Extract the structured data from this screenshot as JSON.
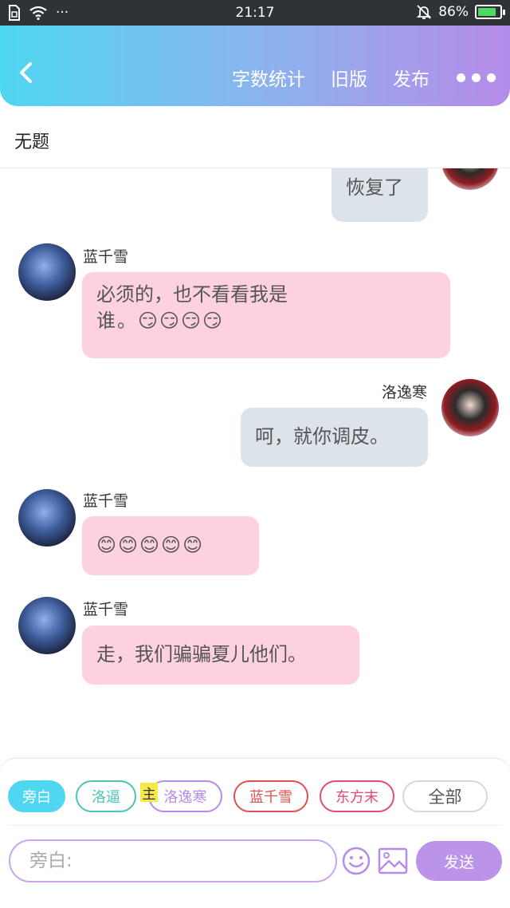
{
  "status_bar": {
    "time": "21:17",
    "battery": "86%",
    "battery_level": 0.86,
    "dots": "···"
  },
  "header": {
    "word_count": "字数统计",
    "old_version": "旧版",
    "publish": "发布"
  },
  "document": {
    "title": "无题"
  },
  "messages": [
    {
      "speaker": "",
      "text": "恢复了",
      "side": "right"
    },
    {
      "speaker": "蓝千雪",
      "line1": "必须的，也不看看我是",
      "line2": "谁。😏😏😏😏",
      "side": "left"
    },
    {
      "speaker": "洛逸寒",
      "text": "呵，就你调皮。",
      "side": "right"
    },
    {
      "speaker": "蓝千雪",
      "text": "😊😊😊😊😊",
      "side": "left"
    },
    {
      "speaker": "蓝千雪",
      "text": "走，我们骗骗夏儿他们。",
      "side": "left"
    }
  ],
  "roles": {
    "narration": "旁白",
    "luo_bi": "洛逼",
    "main_tag": "主",
    "luo_yihan": "洛逸寒",
    "lan_qianxue": "蓝千雪",
    "dong_fangmo": "东方末",
    "all": "全部"
  },
  "composer": {
    "placeholder": "旁白:",
    "send": "发送"
  },
  "colors": {
    "accent_purple": "#bb93e8",
    "bubble_pink": "#fdd1dd",
    "bubble_gray": "#dde3ea"
  }
}
